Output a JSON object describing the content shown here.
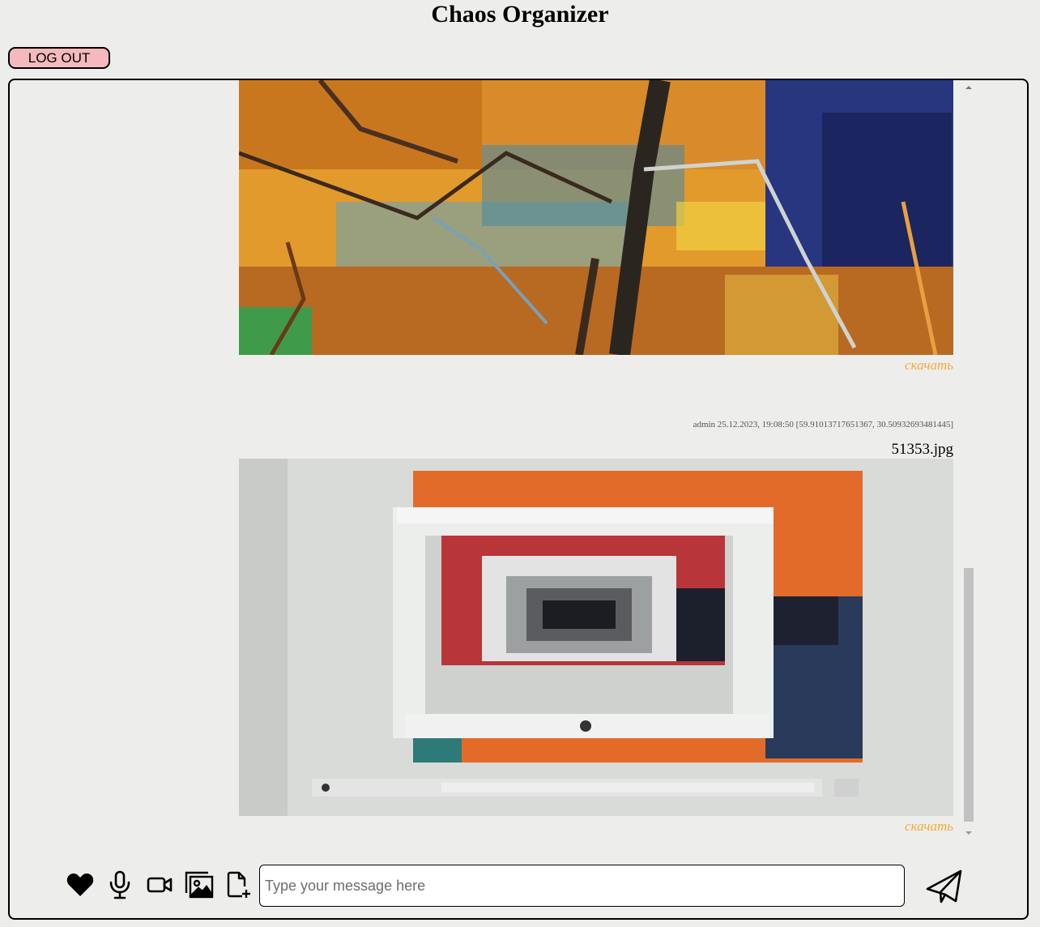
{
  "header": {
    "title": "Chaos Organizer"
  },
  "auth": {
    "logout_label": "LOG OUT"
  },
  "messages": [
    {
      "type": "image",
      "image_alt": "Abstract painting with orange, teal and dark brush strokes",
      "download_label": "скачать"
    },
    {
      "type": "image",
      "author": "admin",
      "timestamp": "25.12.2023, 19:08:50",
      "coords": "[59.91013717651367, 30.50932693481445]",
      "meta_text": "admin 25.12.2023, 19:08:50 [59.91013717651367, 30.50932693481445]",
      "filename": "51353.jpg",
      "image_alt": "Photo of a screen showing the chat app recursively",
      "download_label": "скачать"
    }
  ],
  "toolbar": {
    "icons": [
      "heart-icon",
      "microphone-icon",
      "video-camera-icon",
      "image-icon",
      "file-add-icon"
    ]
  },
  "composer": {
    "placeholder": "Type your message here",
    "value": ""
  },
  "send": {
    "icon": "paper-plane-icon"
  },
  "colors": {
    "background": "#edeeeb",
    "logout_bg": "#f4b9bc",
    "download_link": "#f5a93a"
  }
}
